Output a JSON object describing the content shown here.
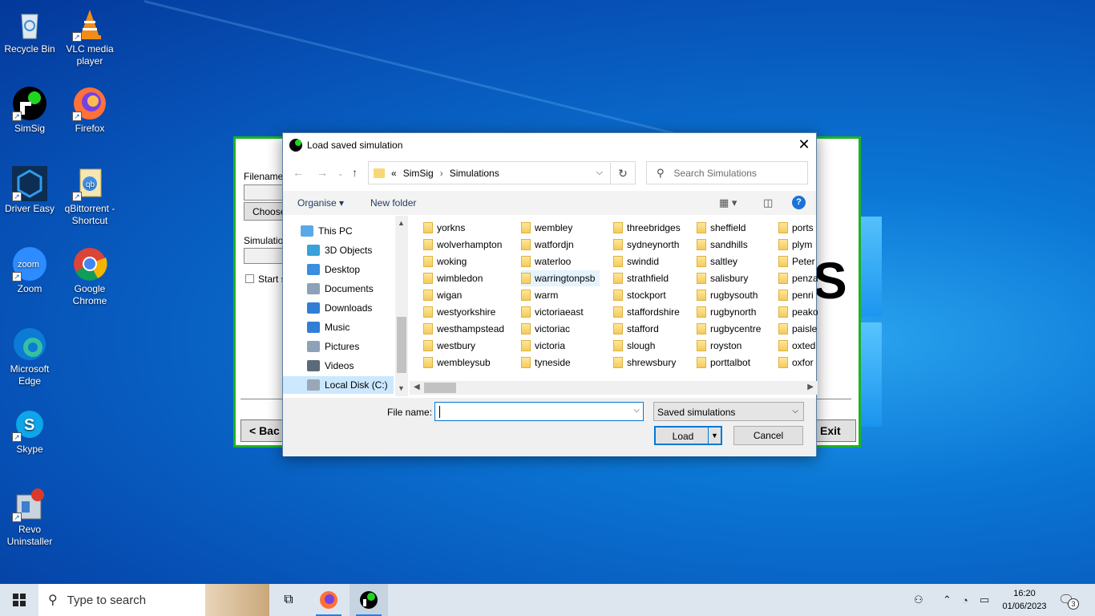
{
  "desktop": {
    "icons": [
      {
        "label": "Recycle Bin",
        "icon": "recycle-bin-icon"
      },
      {
        "label": "VLC media player",
        "icon": "vlc-icon"
      },
      {
        "label": "SimSig",
        "icon": "simsig-icon"
      },
      {
        "label": "Firefox",
        "icon": "firefox-icon"
      },
      {
        "label": "Driver Easy",
        "icon": "driver-easy-icon"
      },
      {
        "label": "qBittorrent - Shortcut",
        "icon": "qbittorrent-icon"
      },
      {
        "label": "Zoom",
        "icon": "zoom-icon"
      },
      {
        "label": "Google Chrome",
        "icon": "chrome-icon"
      },
      {
        "label": "Microsoft Edge",
        "icon": "edge-icon"
      },
      {
        "label": "Skype",
        "icon": "skype-icon"
      },
      {
        "label": "Revo Uninstaller",
        "icon": "revo-icon"
      }
    ]
  },
  "simsig_window": {
    "filename_label": "Filename",
    "choose_label": "Choose",
    "simulation_label": "Simulatio",
    "start_label": "Start s",
    "back_label": "< Bac",
    "exit_label": "Exit",
    "big_letter": "S"
  },
  "dialog": {
    "title": "Load saved simulation",
    "breadcrumb": {
      "root": "«",
      "parent": "SimSig",
      "current": "Simulations"
    },
    "search_placeholder": "Search Simulations",
    "toolbar": {
      "organise": "Organise",
      "new_folder": "New folder"
    },
    "nav": [
      {
        "label": "This PC",
        "icon": "this-pc-icon",
        "color": "#5aa9e6"
      },
      {
        "label": "3D Objects",
        "icon": "3d-objects-icon",
        "color": "#37a3d9"
      },
      {
        "label": "Desktop",
        "icon": "desktop-icon",
        "color": "#3a8ee0"
      },
      {
        "label": "Documents",
        "icon": "documents-icon",
        "color": "#8da2b8"
      },
      {
        "label": "Downloads",
        "icon": "downloads-icon",
        "color": "#2f7fd6"
      },
      {
        "label": "Music",
        "icon": "music-icon",
        "color": "#2f7fd6"
      },
      {
        "label": "Pictures",
        "icon": "pictures-icon",
        "color": "#8da2b8"
      },
      {
        "label": "Videos",
        "icon": "videos-icon",
        "color": "#5b6a78"
      },
      {
        "label": "Local Disk (C:)",
        "icon": "local-disk-icon",
        "color": "#9aa8b6"
      }
    ],
    "folders": [
      [
        "yorkns",
        "wolverhampton",
        "woking",
        "wimbledon",
        "wigan",
        "westyorkshire",
        "westhampstead",
        "westbury",
        "wembleysub"
      ],
      [
        "wembley",
        "watfordjn",
        "waterloo",
        "warringtonpsb",
        "warm",
        "victoriaeast",
        "victoriac",
        "victoria",
        "tyneside"
      ],
      [
        "threebridges",
        "sydneynorth",
        "swindid",
        "strathfield",
        "stockport",
        "staffordshire",
        "stafford",
        "slough",
        "shrewsbury"
      ],
      [
        "sheffield",
        "sandhills",
        "saltley",
        "salisbury",
        "rugbysouth",
        "rugbynorth",
        "rugbycentre",
        "royston",
        "porttalbot"
      ],
      [
        "ports",
        "plym",
        "Peter",
        "penza",
        "penri",
        "peako",
        "paisle",
        "oxted",
        "oxfor"
      ]
    ],
    "file_name_label": "File name:",
    "file_name_value": "",
    "file_type": "Saved simulations",
    "load_label": "Load",
    "cancel_label": "Cancel"
  },
  "taskbar": {
    "search_placeholder": "Type to search",
    "time": "16:20",
    "date": "01/06/2023",
    "notification_count": "3"
  }
}
